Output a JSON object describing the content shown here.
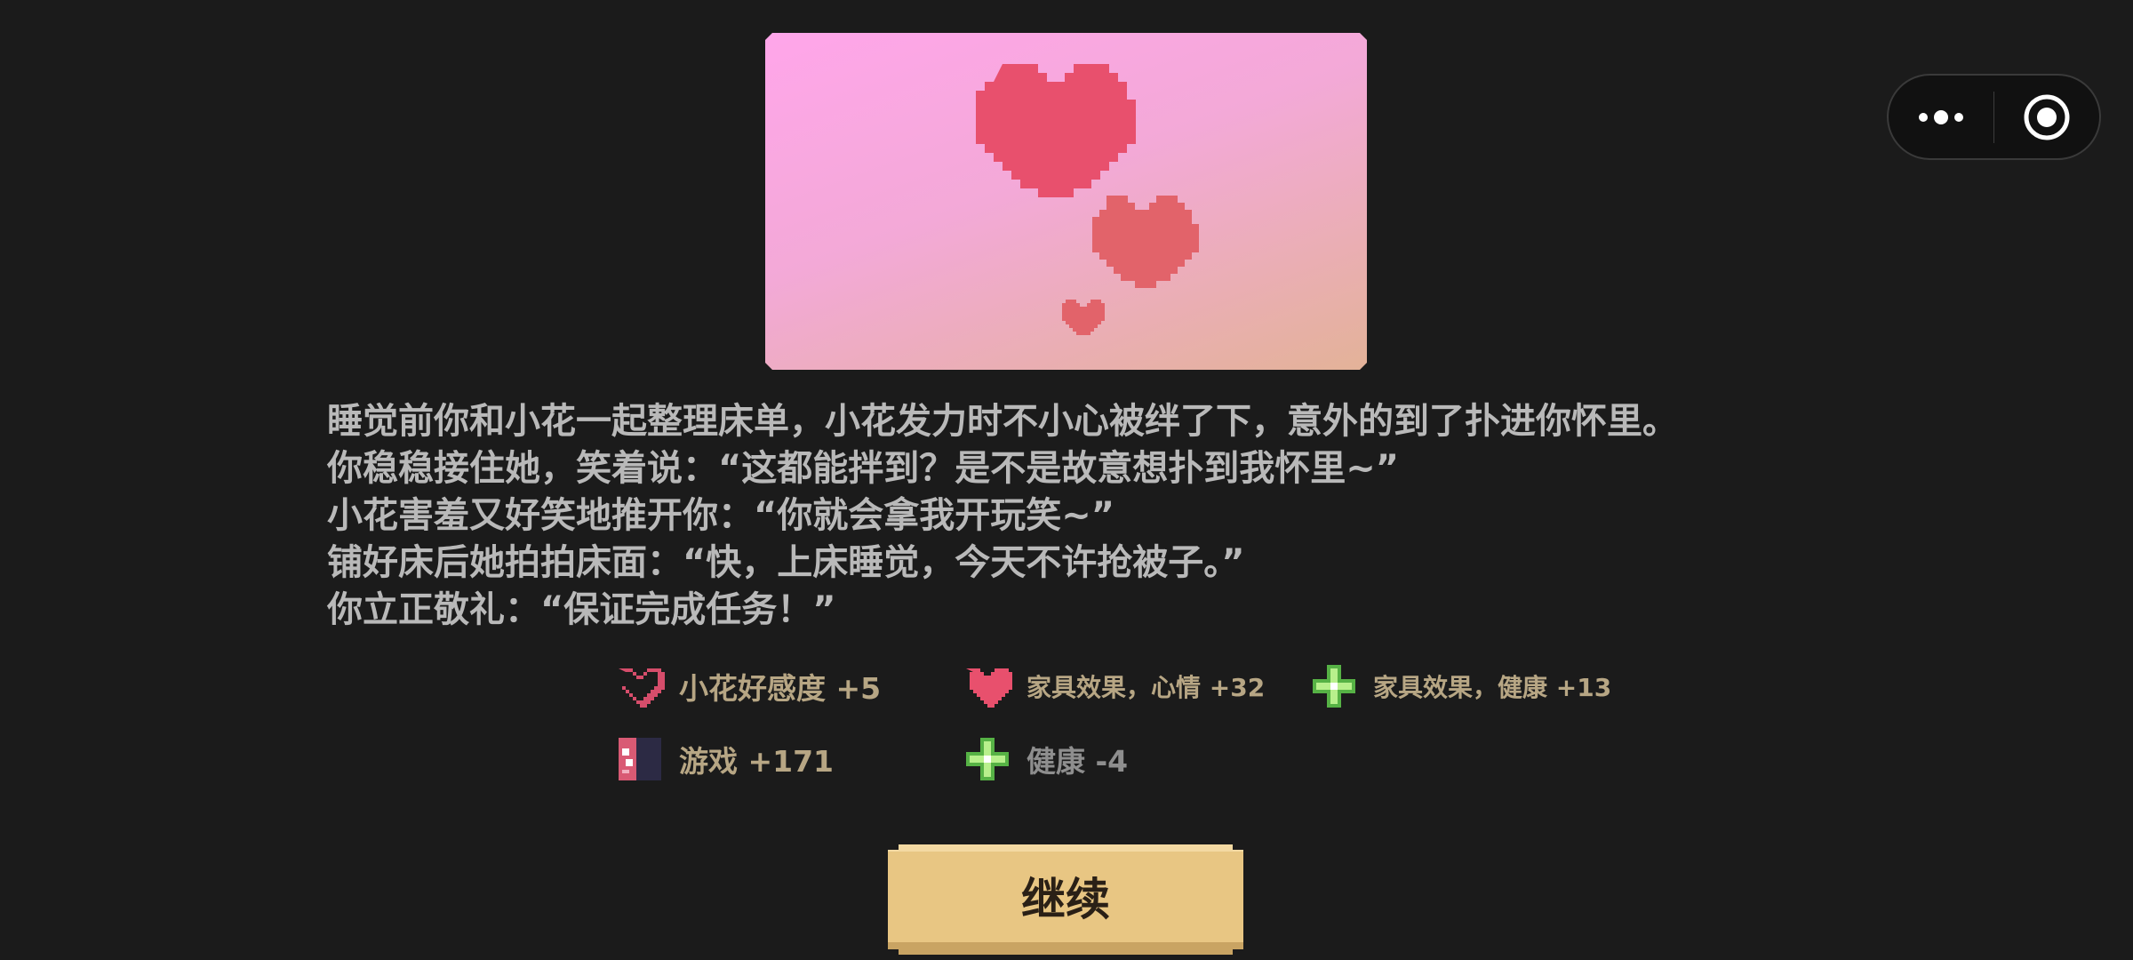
{
  "story": {
    "lines": [
      "睡觉前你和小花一起整理床单，小花发力时不小心被绊了下，意外的到了扑进你怀里。",
      "你稳稳接住她，笑着说：“这都能拌到？是不是故意想扑到我怀里~”",
      "小花害羞又好笑地推开你：“你就会拿我开玩笑~”",
      "铺好床后她拍拍床面：“快，上床睡觉，今天不许抢被子。”",
      "你立正敬礼：“保证完成任务！”"
    ]
  },
  "rewards": [
    {
      "icon": "heart-outline-icon",
      "label": "小花好感度 +5"
    },
    {
      "icon": "heart-icon",
      "label": "家具效果，心情 +32"
    },
    {
      "icon": "green-cross-icon",
      "label": "家具效果，健康 +13"
    },
    {
      "icon": "game-cartridge-icon",
      "label": "游戏 +171"
    },
    {
      "icon": "green-cross-icon",
      "label": "健康 -4"
    }
  ],
  "continue_button": {
    "label": "继续"
  },
  "colors": {
    "background": "#1b1b1b",
    "story_text": "#b9b9b9",
    "reward_text": "#b7a684",
    "button": "#e8c683",
    "heart": "#e8506d"
  }
}
